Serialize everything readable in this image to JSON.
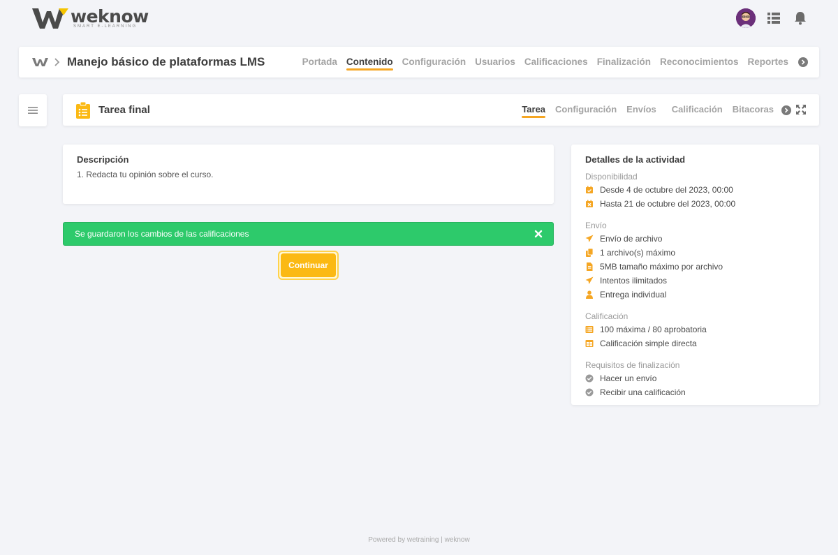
{
  "brand": {
    "name": "weknow",
    "tagline": "SMART E-LEARNING",
    "accent": "#f5a623"
  },
  "course": {
    "title": "Manejo básico de plataformas LMS",
    "tabs": [
      "Portada",
      "Contenido",
      "Configuración",
      "Usuarios",
      "Calificaciones",
      "Finalización",
      "Reconocimientos",
      "Reportes"
    ],
    "active_tab": "Contenido"
  },
  "activity": {
    "title": "Tarea final",
    "tabs": [
      "Tarea",
      "Configuración",
      "Envíos",
      "Calificación",
      "Bitacoras"
    ],
    "active_tab": "Tarea"
  },
  "description": {
    "title": "Descripción",
    "body": "1. Redacta tu opinión sobre el curso."
  },
  "alert": {
    "text": "Se guardaron los cambios de las calificaciones",
    "color": "#2dca6b"
  },
  "continue_label": "Continuar",
  "details": {
    "title": "Detalles de la actividad",
    "availability_label": "Disponibilidad",
    "availability": [
      {
        "icon": "calendar-check-icon",
        "text": "Desde 4 de octubre del 2023, 00:00"
      },
      {
        "icon": "calendar-x-icon",
        "text": "Hasta 21 de octubre del 2023, 00:00"
      }
    ],
    "submission_label": "Envío",
    "submission": [
      {
        "icon": "paper-plane-icon",
        "text": "Envío de archivo"
      },
      {
        "icon": "files-icon",
        "text": "1 archivo(s) máximo"
      },
      {
        "icon": "file-size-icon",
        "text": "5MB tamaño máximo por archivo"
      },
      {
        "icon": "paper-plane-icon",
        "text": "Intentos ilimitados"
      },
      {
        "icon": "user-icon",
        "text": "Entrega individual"
      }
    ],
    "grading_label": "Calificación",
    "grading": [
      {
        "icon": "list-icon",
        "text": "100 máxima / 80 aprobatoria"
      },
      {
        "icon": "table-icon",
        "text": "Calificación simple directa"
      }
    ],
    "completion_label": "Requisitos de finalización",
    "completion": [
      {
        "icon": "check-circle-icon",
        "text": "Hacer un envío"
      },
      {
        "icon": "check-circle-icon",
        "text": "Recibir una calificación"
      }
    ]
  },
  "footer": "Powered by wetraining | weknow"
}
